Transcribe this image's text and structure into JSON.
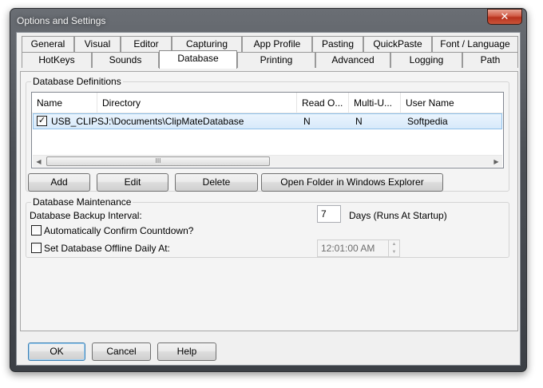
{
  "window": {
    "title": "Options and Settings",
    "close_glyph": "✕"
  },
  "tabs_row1": [
    {
      "label": "General"
    },
    {
      "label": "Visual"
    },
    {
      "label": "Editor"
    },
    {
      "label": "Capturing"
    },
    {
      "label": "App Profile"
    },
    {
      "label": "Pasting"
    },
    {
      "label": "QuickPaste"
    },
    {
      "label": "Font / Language"
    }
  ],
  "tabs_row2": [
    {
      "label": "HotKeys"
    },
    {
      "label": "Sounds"
    },
    {
      "label": "Database",
      "active": true
    },
    {
      "label": "Printing"
    },
    {
      "label": "Advanced"
    },
    {
      "label": "Logging"
    },
    {
      "label": "Path"
    }
  ],
  "definitions": {
    "group_label": "Database Definitions",
    "columns": [
      "Name",
      "Directory",
      "Read O...",
      "Multi-U...",
      "User Name"
    ],
    "rows": [
      {
        "checked": true,
        "check_glyph": "✓",
        "name": "USB_CLIPS",
        "directory": "J:\\Documents\\ClipMateDatabase",
        "read_only": "N",
        "multi_user": "N",
        "user_name": "Softpedia"
      }
    ],
    "scroll_left": "◀",
    "scroll_right": "▶",
    "scroll_grip": "III",
    "buttons": {
      "add": "Add",
      "edit": "Edit",
      "delete": "Delete",
      "open_folder": "Open Folder in Windows Explorer"
    }
  },
  "maintenance": {
    "group_label": "Database Maintenance",
    "backup_label": "Database Backup Interval:",
    "backup_value": "7",
    "backup_unit": "Days (Runs At Startup)",
    "auto_confirm_label": "Automatically Confirm Countdown?",
    "auto_confirm_checked": false,
    "offline_label": "Set Database Offline Daily At:",
    "offline_checked": false,
    "offline_time": "12:01:00 AM",
    "spin_up": "▲",
    "spin_down": "▼"
  },
  "footer": {
    "ok": "OK",
    "cancel": "Cancel",
    "help": "Help"
  }
}
